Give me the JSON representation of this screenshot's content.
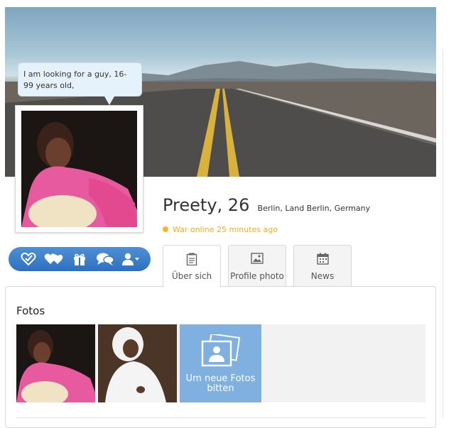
{
  "profile": {
    "bubble_text": "I am looking for a guy, 16-99 years old,",
    "name_age": "Preety, 26",
    "location": "Berlin, Land Berlin, Germany",
    "status": "War online 25 minutes ago"
  },
  "actions": [
    {
      "icon": "checkmark-heart-icon"
    },
    {
      "icon": "hearts-icon"
    },
    {
      "icon": "gift-icon"
    },
    {
      "icon": "chat-bubbles-icon"
    },
    {
      "icon": "user-dropdown-icon"
    }
  ],
  "tabs": [
    {
      "label": "Über sich",
      "icon": "notepad-icon",
      "active": true
    },
    {
      "label": "Profile photo",
      "icon": "image-icon",
      "active": false
    },
    {
      "label": "News",
      "icon": "calendar-icon",
      "active": false
    }
  ],
  "fotos": {
    "title": "Fotos",
    "upload_label": "Um neue Fotos bitten"
  },
  "colors": {
    "accent_blue": "#2d70c0",
    "status_orange": "#f0ad1a",
    "upload_tile": "#7fb0e0"
  }
}
